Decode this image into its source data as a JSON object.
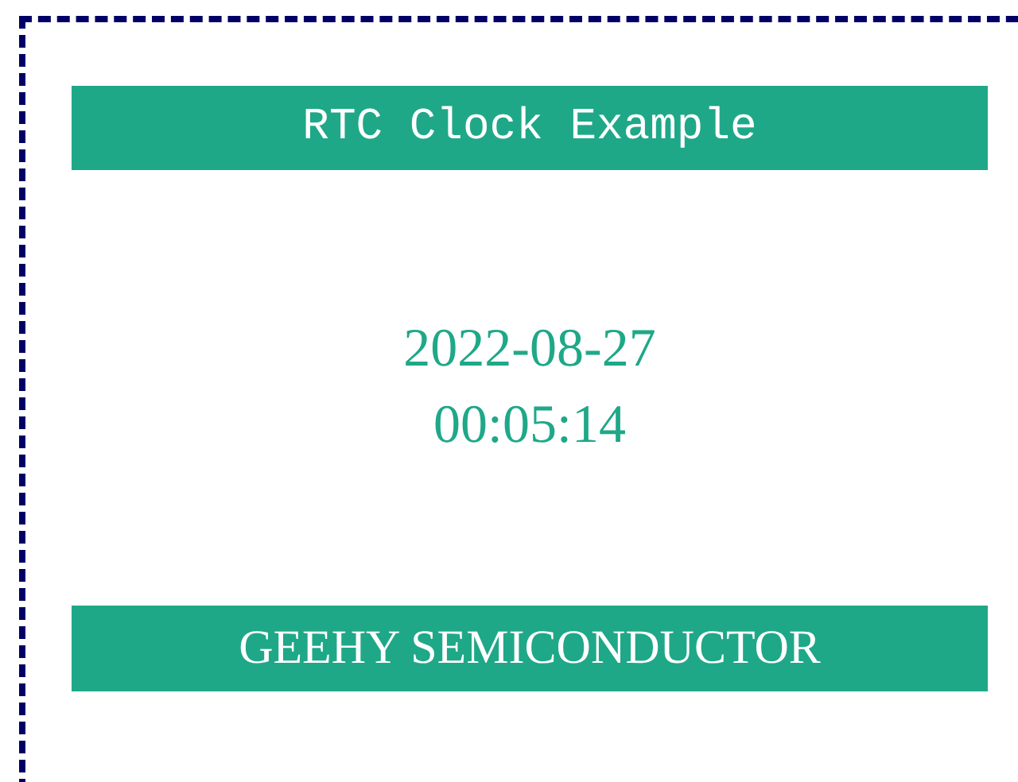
{
  "header": {
    "title": "RTC Clock Example"
  },
  "clock": {
    "date": "2022-08-27",
    "time": "00:05:14"
  },
  "footer": {
    "text": "GEEHY SEMICONDUCTOR"
  }
}
